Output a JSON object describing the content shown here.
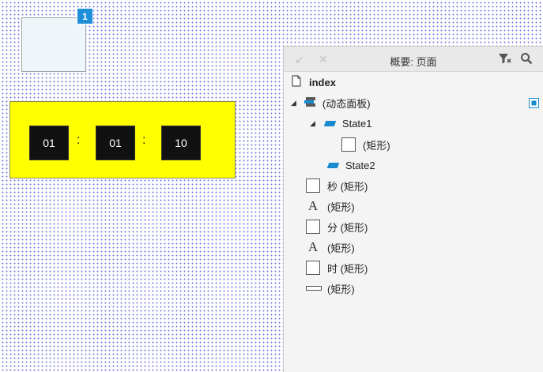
{
  "canvas": {
    "badge": "1",
    "timer": {
      "digits": [
        "01",
        "01",
        "10"
      ],
      "separator": ":"
    }
  },
  "outline": {
    "title": "概要: 页面",
    "toolbar": {
      "back_icon": "arrow-down-left-icon",
      "close_icon": "close-icon",
      "filter_icon": "filter-icon",
      "search_icon": "search-icon"
    },
    "root": "index",
    "dynamic_panel": "(动态面板)",
    "state1": "State1",
    "state1_child": "(矩形)",
    "state2": "State2",
    "items": [
      {
        "label": "秒 (矩形)",
        "icon": "checkbox-rect-icon"
      },
      {
        "label": "(矩形)",
        "icon": "text-a-icon"
      },
      {
        "label": "分 (矩形)",
        "icon": "checkbox-rect-icon"
      },
      {
        "label": "(矩形)",
        "icon": "text-a-icon"
      },
      {
        "label": "时 (矩形)",
        "icon": "checkbox-rect-icon"
      },
      {
        "label": "(矩形)",
        "icon": "flat-rect-icon"
      }
    ]
  },
  "colors": {
    "accent": "#1a8ad0",
    "timer_bg": "#ffff00",
    "digit_bg": "#111111"
  }
}
